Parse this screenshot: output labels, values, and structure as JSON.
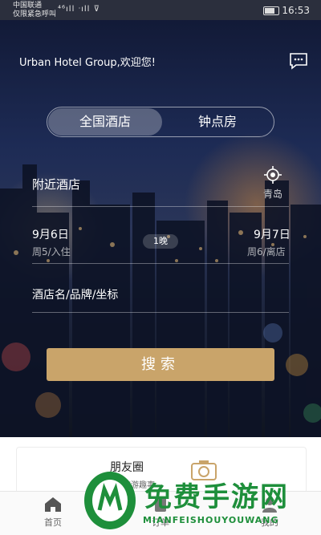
{
  "status_bar": {
    "carrier_line1": "中国联通",
    "carrier_line2": "仅限紧急呼叫",
    "signal_text": "⁴⁶ıll ᐧıll ⊽",
    "time": "16:53"
  },
  "header": {
    "greeting": "Urban Hotel Group,欢迎您!",
    "chat_icon": "chat-bubble-icon"
  },
  "tabs": [
    {
      "label": "全国酒店",
      "active": true
    },
    {
      "label": "钟点房",
      "active": false
    }
  ],
  "search_form": {
    "location_label": "附近酒店",
    "city": "青岛",
    "checkin_date": "9月6日",
    "checkin_sub": "周5/入住",
    "nights": "1晚",
    "checkout_date": "9月7日",
    "checkout_sub": "周6/离店",
    "keyword_placeholder": "酒店名/品牌/坐标",
    "search_button": "搜索"
  },
  "moments_card": {
    "title": "朋友圈",
    "subtitle": "…旅游趣事"
  },
  "bottom_nav": [
    {
      "label": "首页",
      "icon": "home-icon"
    },
    {
      "label": "订单",
      "icon": "order-icon"
    },
    {
      "label": "我的",
      "icon": "user-icon"
    }
  ],
  "watermark": {
    "title": "免费手游网",
    "subtitle": "MIANFEISHOUYOUWANG"
  },
  "colors": {
    "accent": "#c9a46a",
    "watermark_green": "#1e8f3b"
  }
}
